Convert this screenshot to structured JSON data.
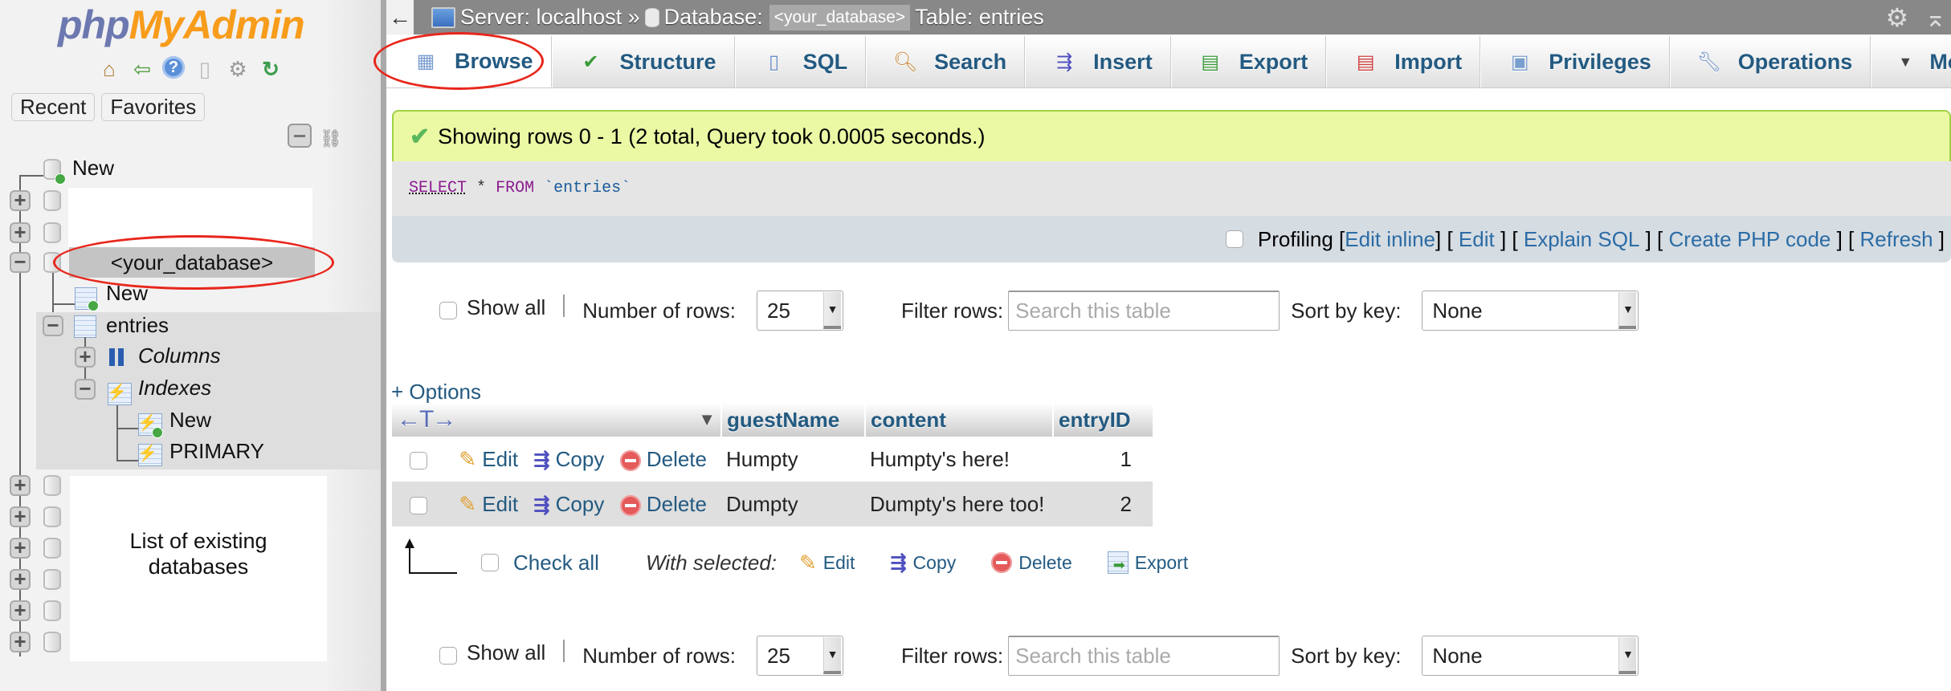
{
  "sidebar": {
    "logo": {
      "part1": "php",
      "part2": "MyAdmin"
    },
    "nav_icons": [
      "home-icon",
      "logout-icon",
      "help-icon",
      "docs-icon",
      "settings-icon",
      "reload-icon"
    ],
    "tabs": [
      {
        "label": "Recent"
      },
      {
        "label": "Favorites"
      }
    ],
    "tree": {
      "new_db_label": "New",
      "selected_db": "<your_database>",
      "new_table_label": "New",
      "table": "entries",
      "columns_label": "Columns",
      "indexes_label": "Indexes",
      "index_items": [
        {
          "label": "New"
        },
        {
          "label": "PRIMARY"
        }
      ]
    },
    "annotation": {
      "line1": "List of existing",
      "line2": "databases"
    }
  },
  "topbar": {
    "back": "←",
    "server": "Server: localhost »",
    "database_label": "Database:",
    "database": "<your_database>",
    "table": "Table: entries"
  },
  "tabs": [
    {
      "label": "Browse",
      "icon": "browse-icon",
      "active": true
    },
    {
      "label": "Structure",
      "icon": "structure-icon"
    },
    {
      "label": "SQL",
      "icon": "sql-icon"
    },
    {
      "label": "Search",
      "icon": "search-icon"
    },
    {
      "label": "Insert",
      "icon": "insert-icon"
    },
    {
      "label": "Export",
      "icon": "export-icon"
    },
    {
      "label": "Import",
      "icon": "import-icon"
    },
    {
      "label": "Privileges",
      "icon": "privileges-icon"
    },
    {
      "label": "Operations",
      "icon": "operations-icon"
    },
    {
      "label": "More",
      "icon": "more-triangle-icon"
    }
  ],
  "message": "Showing rows 0 - 1 (2 total, Query took 0.0005 seconds.)",
  "query": {
    "select": "SELECT",
    "star": "*",
    "from": "FROM",
    "table": "`entries`"
  },
  "query_tools": {
    "profiling": "Profiling",
    "edit_inline": "Edit inline",
    "edit": "Edit",
    "explain": "Explain SQL",
    "php": "Create PHP code",
    "refresh": "Refresh"
  },
  "navigation": {
    "show_all": "Show all",
    "rows_label": "Number of rows:",
    "rows_value": "25",
    "filter_label": "Filter rows:",
    "filter_placeholder": "Search this table",
    "sort_label": "Sort by key:",
    "sort_value": "None"
  },
  "options_link": "+ Options",
  "table": {
    "resize_glyph": "←T→",
    "columns": [
      "guestName",
      "content",
      "entryID"
    ],
    "actions": {
      "edit": "Edit",
      "copy": "Copy",
      "delete": "Delete"
    },
    "rows": [
      {
        "guestName": "Humpty",
        "content": "Humpty's here!",
        "entryID": "1"
      },
      {
        "guestName": "Dumpty",
        "content": "Dumpty's here too!",
        "entryID": "2"
      }
    ]
  },
  "bulk": {
    "check_all": "Check all",
    "with_selected": "With selected:",
    "edit": "Edit",
    "copy": "Copy",
    "delete": "Delete",
    "export": "Export"
  },
  "annotation_color": "#e8261c"
}
